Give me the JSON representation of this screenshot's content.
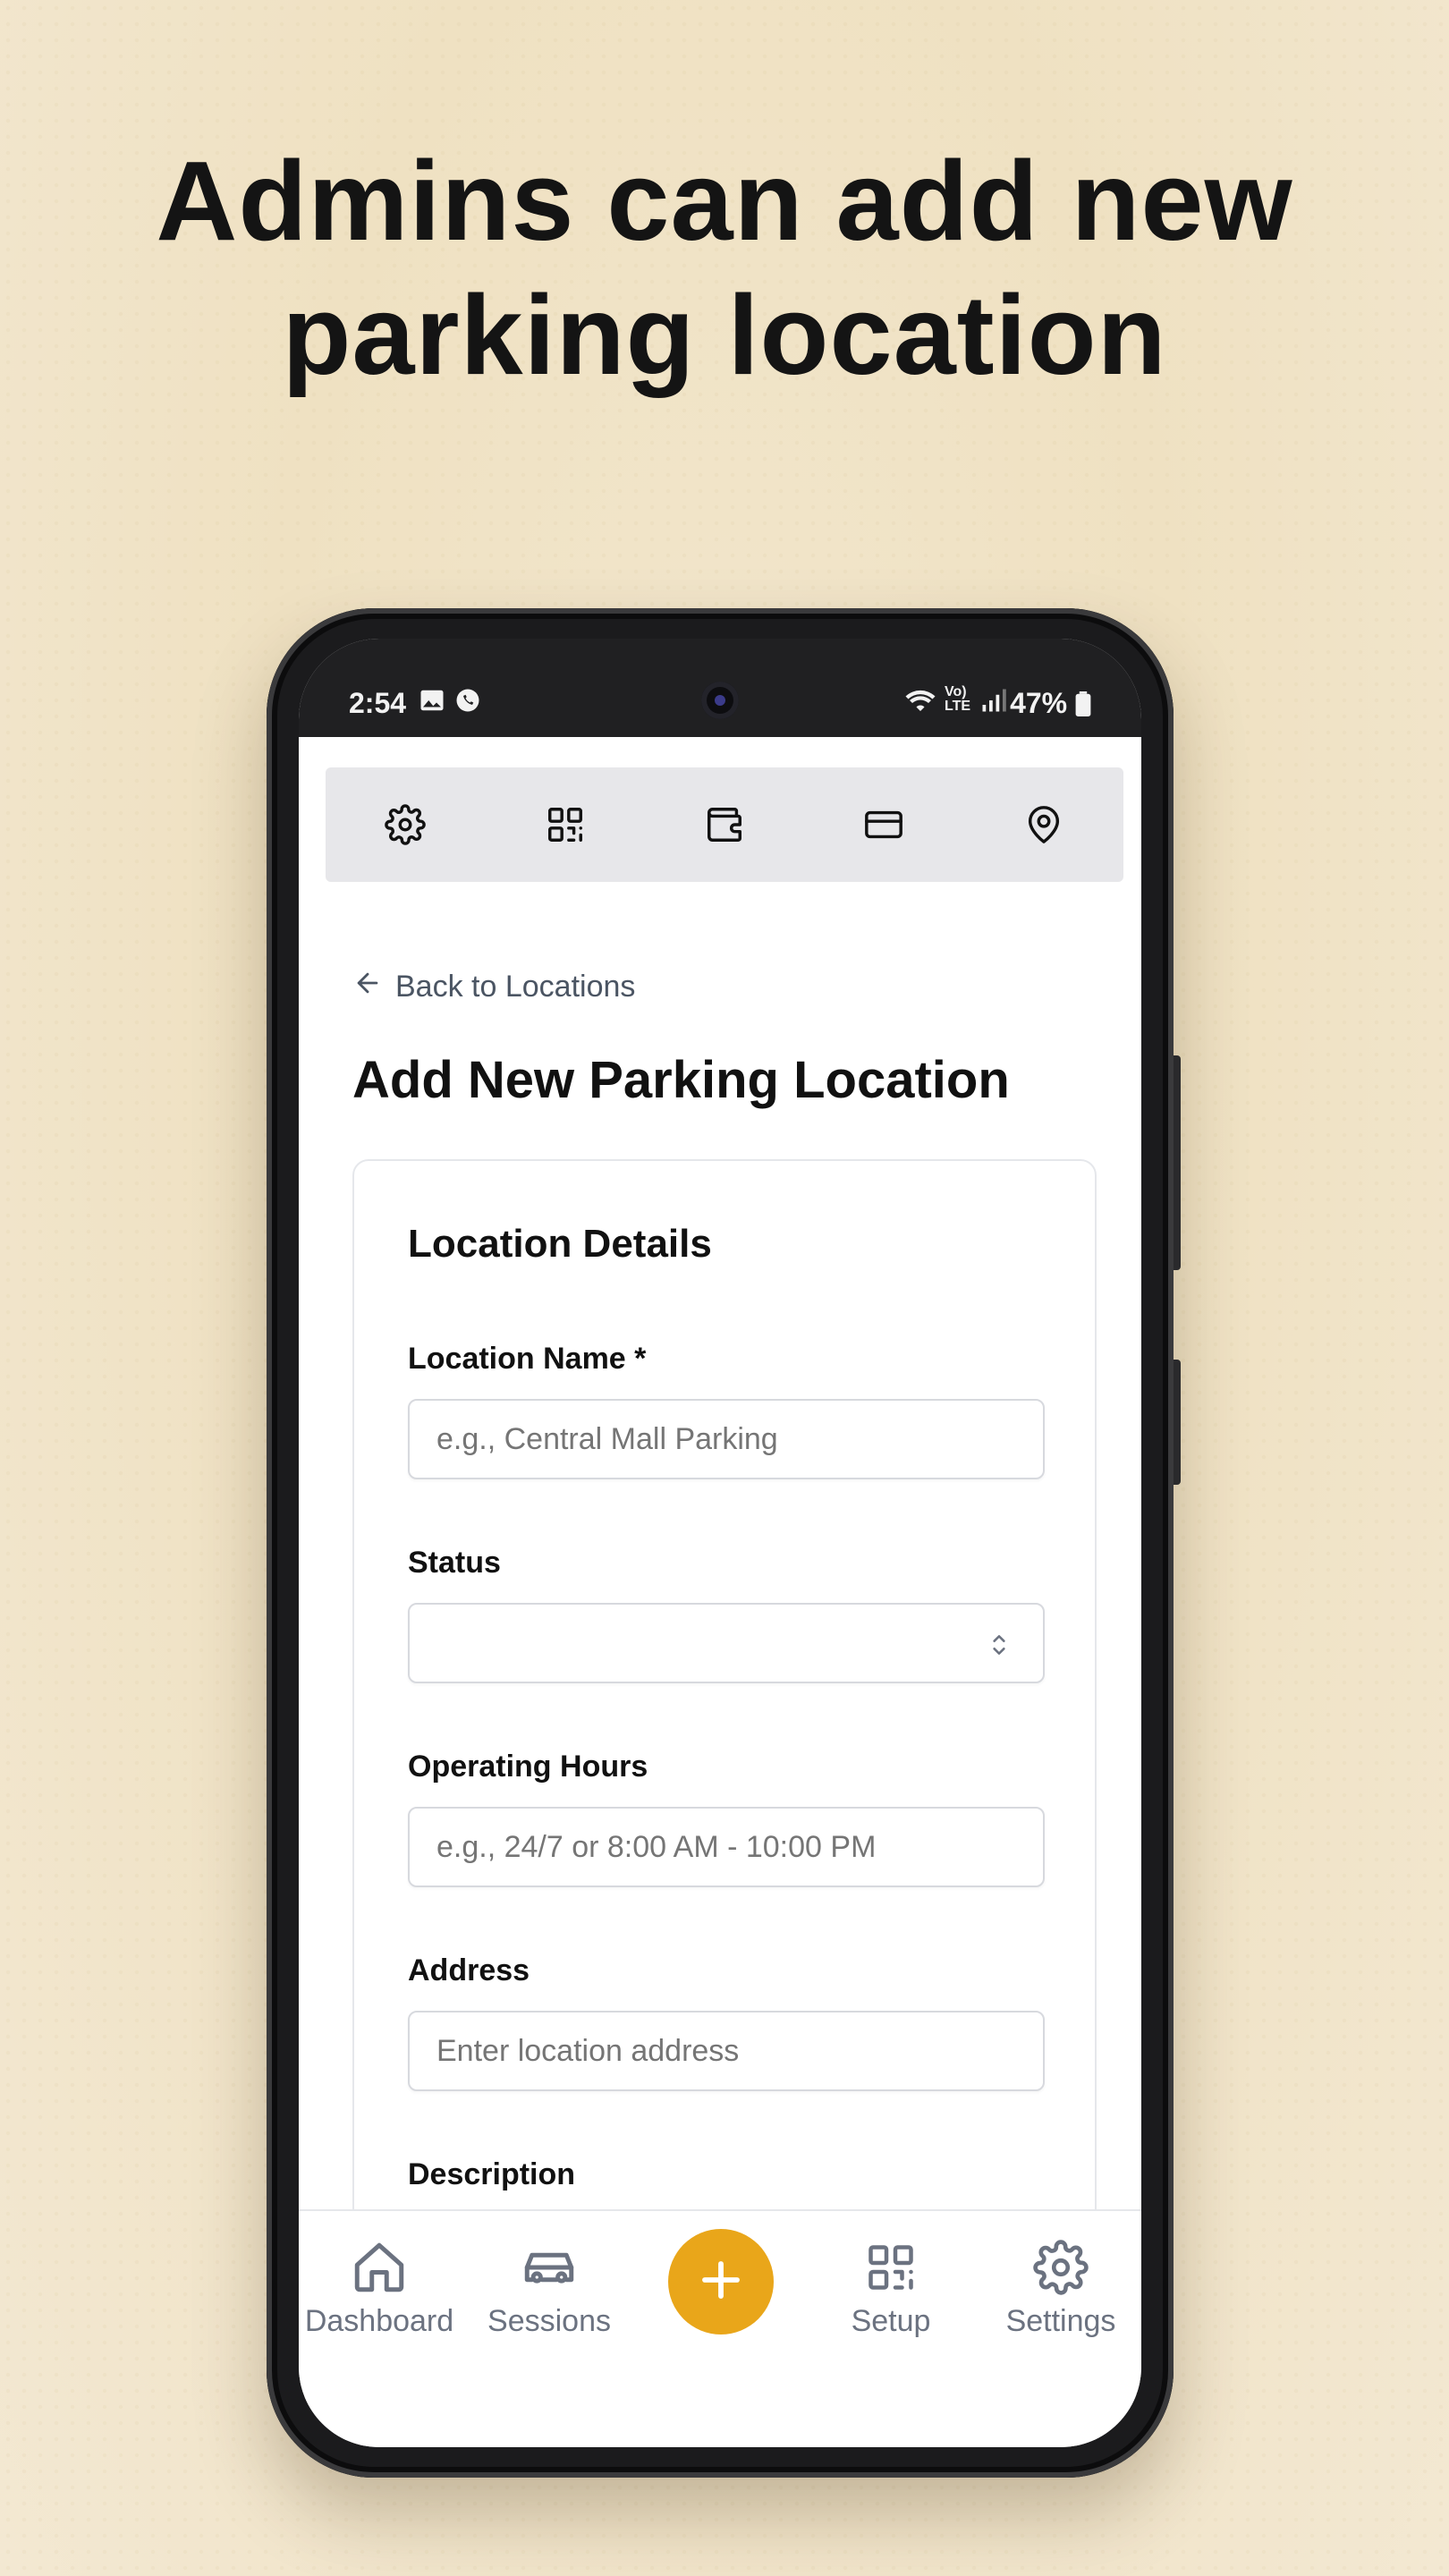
{
  "headline": {
    "line1": "Admins can add new",
    "line2": "parking location"
  },
  "status_bar": {
    "time": "2:54",
    "battery": "47%",
    "icons": [
      "image-icon",
      "whatsapp-icon",
      "wifi-icon",
      "volte-icon",
      "signal-icon",
      "battery-icon"
    ]
  },
  "top_nav": {
    "icons": [
      "gear-icon",
      "qr-code-icon",
      "wallet-icon",
      "credit-card-icon",
      "map-pin-icon"
    ]
  },
  "back_link": "Back to Locations",
  "page_title": "Add New Parking Location",
  "form": {
    "card_title": "Location Details",
    "location_name": {
      "label": "Location Name *",
      "placeholder": "e.g., Central Mall Parking",
      "value": ""
    },
    "status": {
      "label": "Status",
      "value": ""
    },
    "operating_hours": {
      "label": "Operating Hours",
      "placeholder": "e.g., 24/7 or 8:00 AM - 10:00 PM",
      "value": ""
    },
    "address": {
      "label": "Address",
      "placeholder": "Enter location address",
      "value": ""
    },
    "description": {
      "label": "Description"
    }
  },
  "bottom_nav": {
    "items": [
      {
        "label": "Dashboard",
        "icon": "home-icon"
      },
      {
        "label": "Sessions",
        "icon": "car-icon"
      },
      {
        "label": "",
        "icon": "plus-icon"
      },
      {
        "label": "Setup",
        "icon": "qr-code-icon"
      },
      {
        "label": "Settings",
        "icon": "gear-icon"
      }
    ]
  },
  "colors": {
    "accent": "#e9a61a",
    "background": "#f0e3c5",
    "text_primary": "#111111",
    "text_muted": "#6b7280"
  }
}
